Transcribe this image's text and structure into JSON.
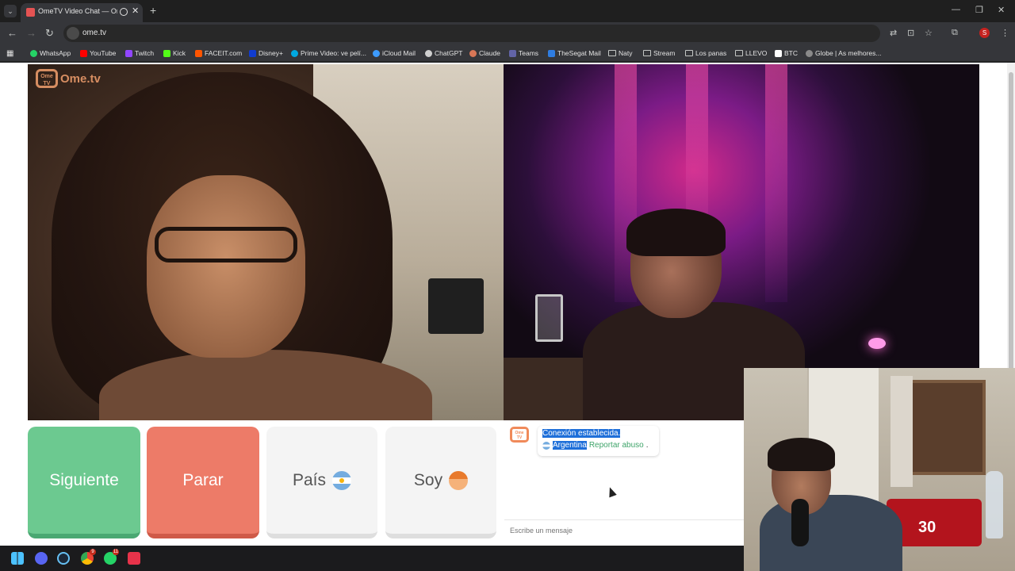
{
  "browser": {
    "tab_title": "OmeTV Video Chat — Ome",
    "url": "ome.tv",
    "new_tab_symbol": "+",
    "close_symbol": "✕",
    "profile_initial": "S"
  },
  "bookmarks": [
    {
      "label": "WhatsApp",
      "color": "#25d366"
    },
    {
      "label": "YouTube",
      "color": "#ff0000"
    },
    {
      "label": "Twitch",
      "color": "#9146ff"
    },
    {
      "label": "Kick",
      "color": "#53fc18"
    },
    {
      "label": "FACEIT.com",
      "color": "#ff5500"
    },
    {
      "label": "Disney+",
      "color": "#113ccf"
    },
    {
      "label": "Prime Video: ve pelí...",
      "color": "#00a8e1"
    },
    {
      "label": "iCloud Mail",
      "color": "#3d9bff"
    },
    {
      "label": "ChatGPT",
      "color": "#cfcfcf"
    },
    {
      "label": "Claude",
      "color": "#d97757"
    },
    {
      "label": "Teams",
      "color": "#6264a7"
    },
    {
      "label": "TheSegat Mail",
      "color": "#2f7de1"
    },
    {
      "label": "Naty",
      "color": "folder"
    },
    {
      "label": "Stream",
      "color": "folder"
    },
    {
      "label": "Los panas",
      "color": "folder"
    },
    {
      "label": "LLEVO",
      "color": "folder"
    },
    {
      "label": "BTC",
      "color": "#ffffff"
    },
    {
      "label": "Globe | As melhores...",
      "color": "#8a8a8a"
    }
  ],
  "video": {
    "logo_text": "Ome.tv",
    "logo_badge": "Ome TV",
    "jersey_number": "30"
  },
  "actions": {
    "next_label": "Siguiente",
    "stop_label": "Parar",
    "country_label": "País",
    "soy_label": "Soy"
  },
  "chat": {
    "logo_badge": "Ome TV",
    "connection_text": "Conexión establecida.",
    "country_name": "Argentina",
    "report_text": "Reportar abuso",
    "input_placeholder": "Escribe un mensaje"
  },
  "taskbar": {
    "chrome_badge": "9",
    "whatsapp_badge": "11"
  },
  "colors": {
    "next_green": "#6cc990",
    "stop_red": "#ed7b68",
    "report_link": "#3fa46a",
    "selection_blue": "#1e6fd9"
  },
  "icons": [
    "tab-list-icon",
    "favicon-icon",
    "record-icon",
    "back-arrow-icon",
    "forward-arrow-icon",
    "reload-icon",
    "site-info-icon",
    "translate-icon",
    "install-icon",
    "star-icon",
    "extensions-icon",
    "kebab-menu-icon",
    "apps-grid-icon",
    "folder-icon",
    "flag-argentina-icon",
    "boy-emoji-icon",
    "windows-start-icon",
    "discord-icon",
    "steam-icon",
    "chrome-icon",
    "whatsapp-icon"
  ]
}
